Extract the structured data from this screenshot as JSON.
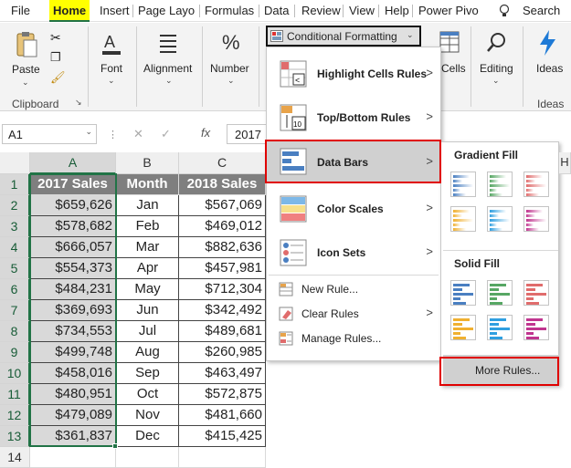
{
  "tabs": [
    "File",
    "Home",
    "Insert",
    "Page Layo",
    "Formulas",
    "Data",
    "Review",
    "View",
    "Help",
    "Power Pivo"
  ],
  "search": {
    "label": "Search",
    "icon": "lightbulb-icon"
  },
  "ribbon": {
    "paste": "Paste",
    "clipboard": "Clipboard",
    "font": "Font",
    "alignment": "Alignment",
    "number": "Number",
    "cond_format": "Conditional Formatting",
    "cells": "Cells",
    "editing": "Editing",
    "ideas_btn": "Ideas",
    "ideas_grp": "Ideas"
  },
  "formula_bar": {
    "name_box": "A1",
    "fx": "fx",
    "value": "2017"
  },
  "columns": [
    "A",
    "B",
    "C"
  ],
  "rows": [
    "1",
    "2",
    "3",
    "4",
    "5",
    "6",
    "7",
    "8",
    "9",
    "10",
    "11",
    "12",
    "13",
    "14"
  ],
  "headers": [
    "2017 Sales",
    "Month",
    "2018 Sales"
  ],
  "table": [
    [
      "$659,626",
      "Jan",
      "$567,069"
    ],
    [
      "$578,682",
      "Feb",
      "$469,012"
    ],
    [
      "$666,057",
      "Mar",
      "$882,636"
    ],
    [
      "$554,373",
      "Apr",
      "$457,981"
    ],
    [
      "$484,231",
      "May",
      "$712,304"
    ],
    [
      "$369,693",
      "Jun",
      "$342,492"
    ],
    [
      "$734,553",
      "Jul",
      "$489,681"
    ],
    [
      "$499,748",
      "Aug",
      "$260,985"
    ],
    [
      "$458,016",
      "Sep",
      "$463,497"
    ],
    [
      "$480,951",
      "Oct",
      "$572,875"
    ],
    [
      "$479,089",
      "Nov",
      "$481,660"
    ],
    [
      "$361,837",
      "Dec",
      "$415,425"
    ]
  ],
  "menu": {
    "highlight": "Highlight Cells Rules",
    "topbottom": "Top/Bottom Rules",
    "databars": "Data Bars",
    "colorscales": "Color Scales",
    "iconsets": "Icon Sets",
    "newrule": "New Rule...",
    "clearrules": "Clear Rules",
    "managerules": "Manage Rules..."
  },
  "submenu": {
    "gradient": "Gradient Fill",
    "solid": "Solid Fill",
    "more": "More Rules..."
  },
  "colors": {
    "excel_green": "#217346",
    "highlight_red": "#e00000",
    "home_yellow": "#ffff00",
    "bar_blue": "#4a7fc1",
    "bar_green": "#57a764",
    "bar_red": "#e06c6c",
    "bar_orange": "#f0b030",
    "bar_lightblue": "#2f9fe0",
    "bar_purple": "#c0358f"
  }
}
